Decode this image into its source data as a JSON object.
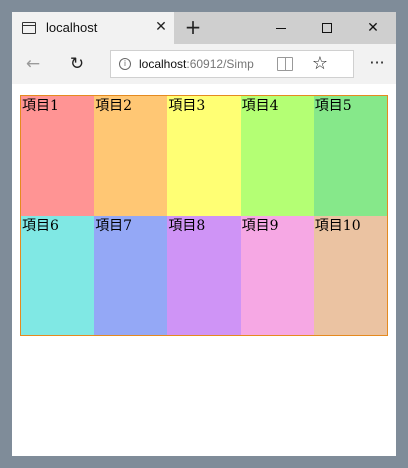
{
  "browser": {
    "tab_title": "localhost",
    "tab_close_glyph": "✕",
    "new_tab_glyph": "+",
    "window_close_glyph": "✕",
    "url_host": "localhost",
    "url_rest": ":60912/Simp",
    "back_glyph": "←",
    "refresh_glyph": "↻",
    "star_glyph": "☆",
    "more_glyph": "···",
    "info_glyph": "i"
  },
  "grid": {
    "border_color": "#e58a1f",
    "items": [
      {
        "label": "項目1",
        "color": "#ff9494"
      },
      {
        "label": "項目2",
        "color": "#ffc774"
      },
      {
        "label": "項目3",
        "color": "#ffff74"
      },
      {
        "label": "項目4",
        "color": "#b4ff74"
      },
      {
        "label": "項目5",
        "color": "#86e88a"
      },
      {
        "label": "項目6",
        "color": "#80e8e4"
      },
      {
        "label": "項目7",
        "color": "#94a8f6"
      },
      {
        "label": "項目8",
        "color": "#cf94f6"
      },
      {
        "label": "項目9",
        "color": "#f6a8e4"
      },
      {
        "label": "項目10",
        "color": "#ebc3a2"
      }
    ]
  }
}
